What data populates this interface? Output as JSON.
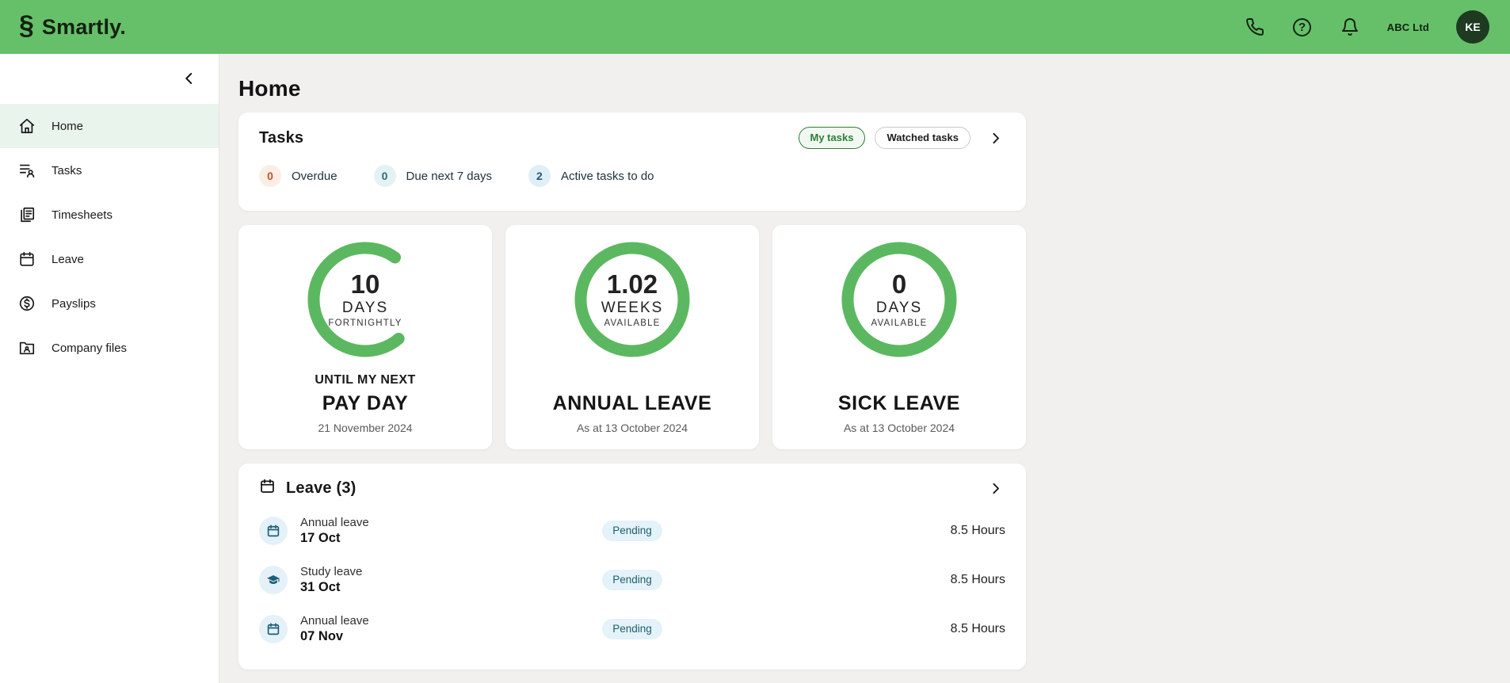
{
  "topbar": {
    "brand": "Smartly.",
    "logo_glyph": "§",
    "help_glyph": "?",
    "company": "ABC Ltd",
    "avatar_initials": "KE"
  },
  "sidebar": {
    "items": [
      {
        "label": "Home",
        "icon": "home-icon",
        "active": true
      },
      {
        "label": "Tasks",
        "icon": "tasks-icon",
        "active": false
      },
      {
        "label": "Timesheets",
        "icon": "timesheets-icon",
        "active": false
      },
      {
        "label": "Leave",
        "icon": "leave-icon",
        "active": false
      },
      {
        "label": "Payslips",
        "icon": "payslips-icon",
        "active": false
      },
      {
        "label": "Company files",
        "icon": "company-files-icon",
        "active": false
      }
    ]
  },
  "page": {
    "title": "Home"
  },
  "tasks_card": {
    "title": "Tasks",
    "filters": [
      {
        "label": "My tasks",
        "active": true
      },
      {
        "label": "Watched tasks",
        "active": false
      }
    ],
    "counts": [
      {
        "value": "0",
        "label": "Overdue",
        "color": "#c05327",
        "bg": "#fcede5"
      },
      {
        "value": "0",
        "label": "Due next 7 days",
        "color": "#2a6f77",
        "bg": "#e4f2f4"
      },
      {
        "value": "2",
        "label": "Active tasks to do",
        "color": "#1d5a7c",
        "bg": "#dfeff8"
      }
    ]
  },
  "stat_cards": [
    {
      "value": "10",
      "unit": "DAYS",
      "sub": "FORTNIGHTLY",
      "line1": "UNTIL MY NEXT",
      "line2": "PAY DAY",
      "date": "21 November 2024",
      "ring_pct": 71
    },
    {
      "value": "1.02",
      "unit": "WEEKS",
      "sub": "AVAILABLE",
      "line1": "",
      "line2": "ANNUAL LEAVE",
      "date": "As at 13 October 2024",
      "ring_pct": 100
    },
    {
      "value": "0",
      "unit": "DAYS",
      "sub": "AVAILABLE",
      "line1": "",
      "line2": "SICK LEAVE",
      "date": "As at 13 October 2024",
      "ring_pct": 100
    }
  ],
  "leave_card": {
    "title": "Leave (3)",
    "rows": [
      {
        "type": "Annual leave",
        "date": "17 Oct",
        "status": "Pending",
        "hours": "8.5 Hours",
        "icon": "calendar-icon"
      },
      {
        "type": "Study leave",
        "date": "31 Oct",
        "status": "Pending",
        "hours": "8.5 Hours",
        "icon": "graduation-cap-icon"
      },
      {
        "type": "Annual leave",
        "date": "07 Nov",
        "status": "Pending",
        "hours": "8.5 Hours",
        "icon": "calendar-icon"
      }
    ]
  },
  "colors": {
    "brand_green": "#66c06a",
    "ring_green": "#5cb860",
    "avatar_bg": "#1e3a21",
    "active_nav_bg": "#e9f4ec",
    "pending_badge_bg": "#e4f2f9",
    "pending_badge_text": "#1d5e6e",
    "main_bg": "#f1f0ee"
  }
}
